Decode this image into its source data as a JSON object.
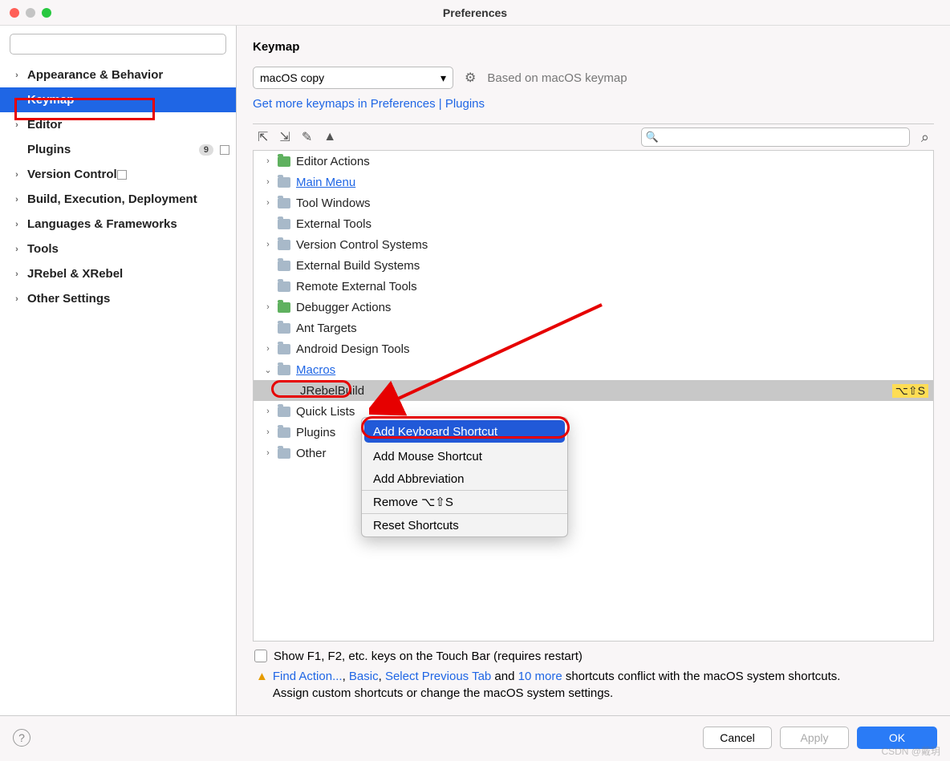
{
  "window": {
    "title": "Preferences"
  },
  "sidebar": {
    "search_placeholder": "",
    "items": [
      {
        "label": "Appearance & Behavior",
        "exp": true
      },
      {
        "label": "Keymap",
        "exp": false,
        "sel": true
      },
      {
        "label": "Editor",
        "exp": true
      },
      {
        "label": "Plugins",
        "exp": false,
        "badge": "9",
        "box": true
      },
      {
        "label": "Version Control",
        "exp": true,
        "box": true
      },
      {
        "label": "Build, Execution, Deployment",
        "exp": true
      },
      {
        "label": "Languages & Frameworks",
        "exp": true
      },
      {
        "label": "Tools",
        "exp": true
      },
      {
        "label": "JRebel & XRebel",
        "exp": true
      },
      {
        "label": "Other Settings",
        "exp": true
      }
    ]
  },
  "panel": {
    "heading": "Keymap",
    "keymap_selected": "macOS copy",
    "based_on": "Based on macOS keymap",
    "more_link_a": "Get more keymaps in Preferences | Plugins",
    "search2_placeholder": "",
    "tree": [
      {
        "label": "Editor Actions",
        "d": 1,
        "exp": true,
        "ic": "green"
      },
      {
        "label": "Main Menu",
        "d": 1,
        "exp": true,
        "lnk": true
      },
      {
        "label": "Tool Windows",
        "d": 1,
        "exp": false
      },
      {
        "label": "External Tools",
        "d": 1,
        "exp": false,
        "noexp": true
      },
      {
        "label": "Version Control Systems",
        "d": 1,
        "exp": true
      },
      {
        "label": "External Build Systems",
        "d": 1,
        "exp": false,
        "noexp": true
      },
      {
        "label": "Remote External Tools",
        "d": 1,
        "exp": false,
        "noexp": true
      },
      {
        "label": "Debugger Actions",
        "d": 1,
        "exp": true,
        "ic": "green"
      },
      {
        "label": "Ant Targets",
        "d": 1,
        "exp": false,
        "noexp": true
      },
      {
        "label": "Android Design Tools",
        "d": 1,
        "exp": true
      },
      {
        "label": "Macros",
        "d": 1,
        "exp": true,
        "open": true,
        "lnk": true
      },
      {
        "label": "JRebelBuild",
        "d": 2,
        "noexp": true,
        "sel": true,
        "short": "⌥⇧S"
      },
      {
        "label": "Quick Lists",
        "d": 1,
        "exp": true
      },
      {
        "label": "Plugins",
        "d": 1,
        "exp": true
      },
      {
        "label": "Other",
        "d": 1,
        "exp": true,
        "ic": "multi"
      }
    ],
    "context_menu": [
      {
        "label": "Add Keyboard Shortcut",
        "sel": true
      },
      {
        "label": "Add Mouse Shortcut"
      },
      {
        "label": "Add Abbreviation"
      },
      {
        "sep": true
      },
      {
        "label": "Remove ⌥⇧S"
      },
      {
        "sep": true
      },
      {
        "label": "Reset Shortcuts"
      }
    ],
    "touchbar_label": "Show F1, F2, etc. keys on the Touch Bar (requires restart)",
    "warn_links": {
      "a": "Find Action...",
      "b": "Basic",
      "c": "Select Previous Tab",
      "d": "10 more"
    },
    "warn_mid": " and ",
    "warn_tail1": " shortcuts conflict with the macOS system shortcuts.",
    "warn_tail2": "Assign custom shortcuts or change the macOS system settings."
  },
  "footer": {
    "cancel": "Cancel",
    "apply": "Apply",
    "ok": "OK"
  },
  "watermark": "CSDN @戴玥"
}
